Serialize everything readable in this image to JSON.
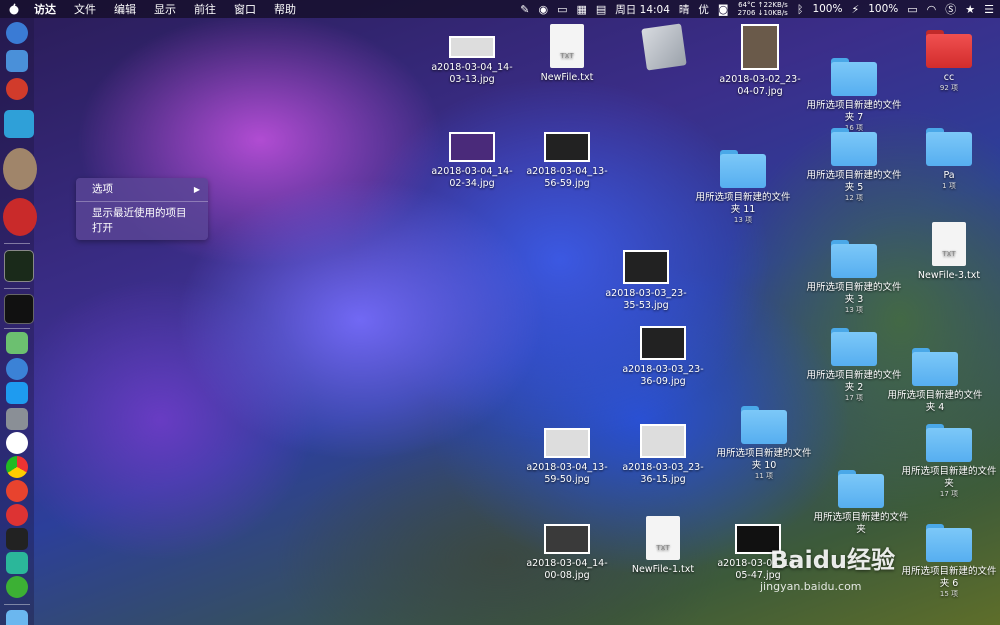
{
  "menubar": {
    "app_name": "访达",
    "menus": [
      "文件",
      "编辑",
      "显示",
      "前往",
      "窗口",
      "帮助"
    ],
    "temp": "64°C",
    "rpm": "2706",
    "net_up": "↑22KB/s",
    "net_down": "↓10KB/s",
    "clock": "周日 14:04",
    "weather": "晴",
    "ime": "优",
    "volume": "100%",
    "battery": "100%"
  },
  "context_menu": {
    "items": [
      "选项",
      "显示最近使用的项目",
      "打开"
    ]
  },
  "desktop_icons": [
    {
      "type": "image",
      "label": "a2018-03-04_14-03-13.jpg"
    },
    {
      "type": "doc",
      "label": "NewFile.txt"
    },
    {
      "type": "app",
      "label": ""
    },
    {
      "type": "image",
      "label": "a2018-03-02_23-04-07.jpg"
    },
    {
      "type": "folder",
      "label": "用所选项目新建的文件夹 7",
      "sub": "16 项"
    },
    {
      "type": "folder-red",
      "label": "cc",
      "sub": "92 项"
    },
    {
      "type": "image",
      "label": "a2018-03-04_14-02-34.jpg"
    },
    {
      "type": "image",
      "label": "a2018-03-04_13-56-59.jpg"
    },
    {
      "type": "folder",
      "label": "用所选项目新建的文件夹 11",
      "sub": "13 项"
    },
    {
      "type": "folder",
      "label": "用所选项目新建的文件夹 5",
      "sub": "12 项"
    },
    {
      "type": "folder",
      "label": "Pa",
      "sub": "1 项"
    },
    {
      "type": "image",
      "label": "a2018-03-03_23-35-53.jpg"
    },
    {
      "type": "folder",
      "label": "用所选项目新建的文件夹 3",
      "sub": "13 项"
    },
    {
      "type": "doc",
      "label": "NewFile-3.txt"
    },
    {
      "type": "image",
      "label": "a2018-03-03_23-36-09.jpg"
    },
    {
      "type": "folder",
      "label": "用所选项目新建的文件夹 2",
      "sub": "17 项"
    },
    {
      "type": "folder",
      "label": "用所选项目新建的文件夹 4",
      "sub": ""
    },
    {
      "type": "image",
      "label": "a2018-03-04_13-59-50.jpg"
    },
    {
      "type": "image",
      "label": "a2018-03-03_23-36-15.jpg"
    },
    {
      "type": "folder",
      "label": "用所选项目新建的文件夹 10",
      "sub": "11 项"
    },
    {
      "type": "folder",
      "label": "用所选项目新建的文件夹",
      "sub": "17 项"
    },
    {
      "type": "folder",
      "label": "用所选项目新建的文件夹",
      "sub": ""
    },
    {
      "type": "image",
      "label": "a2018-03-04_14-00-08.jpg"
    },
    {
      "type": "doc",
      "label": "NewFile-1.txt"
    },
    {
      "type": "image",
      "label": "a2018-03-04_13-05-47.jpg"
    },
    {
      "type": "folder",
      "label": "用所选项目新建的文件夹 6",
      "sub": "15 项"
    }
  ],
  "watermark": {
    "logo": "Baidu经验",
    "url": "jingyan.baidu.com"
  }
}
